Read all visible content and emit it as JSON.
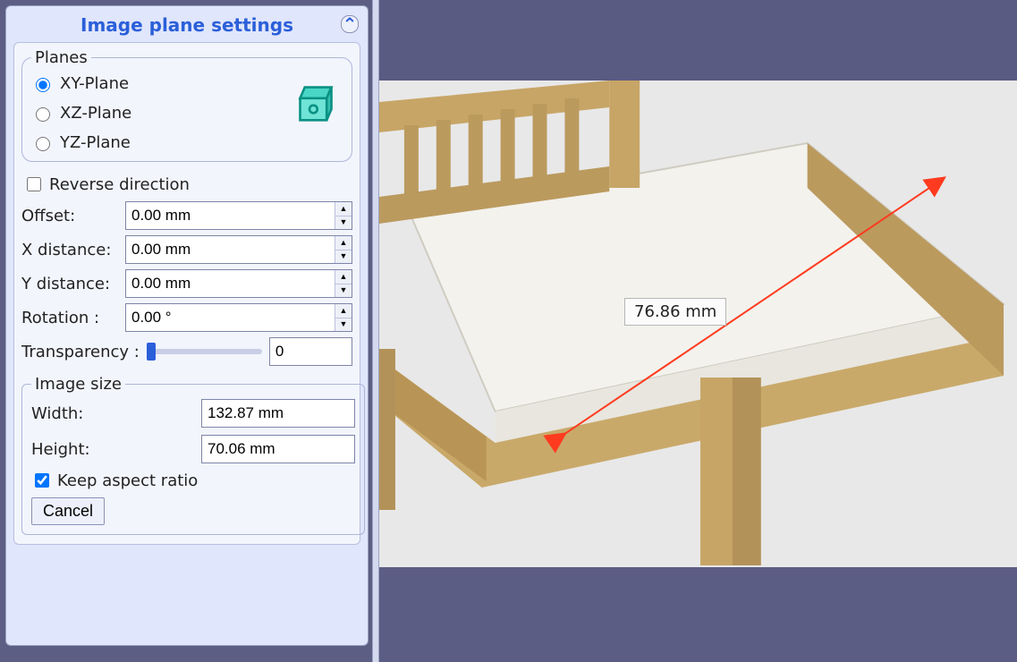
{
  "panel": {
    "title": "Image plane settings",
    "planes_legend": "Planes",
    "planes": {
      "xy": "XY-Plane",
      "xz": "XZ-Plane",
      "yz": "YZ-Plane",
      "selected": "xy"
    },
    "reverse": {
      "label": "Reverse direction",
      "checked": false
    },
    "offset": {
      "label": "Offset:",
      "value": "0.00 mm"
    },
    "xdist": {
      "label": "X distance:",
      "value": "0.00 mm"
    },
    "ydist": {
      "label": "Y distance:",
      "value": "0.00 mm"
    },
    "rotation": {
      "label": "Rotation :",
      "value": "0.00 °"
    },
    "transparency": {
      "label": "Transparency :",
      "value": "0",
      "slider": 0
    },
    "size": {
      "legend": "Image size",
      "width": {
        "label": "Width:",
        "value": "132.87 mm"
      },
      "height": {
        "label": "Height:",
        "value": "70.06 mm"
      },
      "keep": {
        "label": "Keep aspect ratio",
        "checked": true
      }
    },
    "cancel": "Cancel"
  },
  "viewport": {
    "dimension_label": "76.86 mm"
  }
}
